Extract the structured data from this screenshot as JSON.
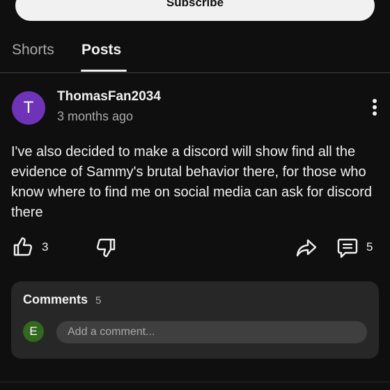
{
  "channel": {
    "subscribe_label": "Subscribe"
  },
  "tabs": [
    {
      "label": "Shorts",
      "active": false
    },
    {
      "label": "Posts",
      "active": true
    }
  ],
  "post": {
    "author": "ThomasFan2034",
    "avatar_letter": "T",
    "avatar_color": "#6f33b7",
    "time": "3 months ago",
    "text": "I've also decided to make a discord will show find all the evidence of Sammy's brutal behavior there, for those who know where to find me on social media can ask for discord there",
    "likes": "3",
    "comments": "5"
  },
  "comments_section": {
    "title": "Comments",
    "count": "5",
    "user_avatar_letter": "E",
    "user_avatar_color": "#33691e",
    "input_placeholder": "Add a comment..."
  },
  "icons": {
    "more": "more-vertical-icon",
    "like": "thumbs-up-icon",
    "dislike": "thumbs-down-icon",
    "share": "share-icon",
    "comment": "comment-icon"
  }
}
